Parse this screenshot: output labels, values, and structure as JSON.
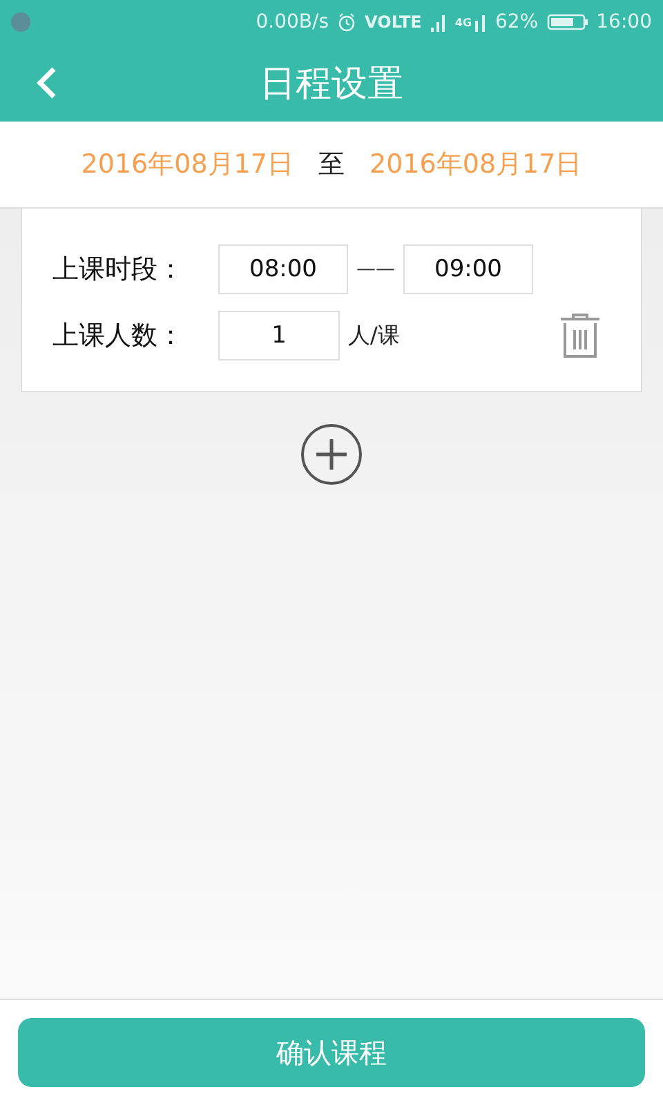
{
  "status_bar": {
    "speed": "0.00B/s",
    "volte": "VOLTE",
    "network": "4G",
    "battery": "62%",
    "time": "16:00"
  },
  "header": {
    "title": "日程设置"
  },
  "date_range": {
    "start": "2016年08月17日",
    "separator": "至",
    "end": "2016年08月17日"
  },
  "session": {
    "time_label": "上课时段：",
    "start_time": "08:00",
    "dash": "——",
    "end_time": "09:00",
    "count_label": "上课人数：",
    "count": "1",
    "unit": "人/课"
  },
  "confirm_button": "确认课程"
}
